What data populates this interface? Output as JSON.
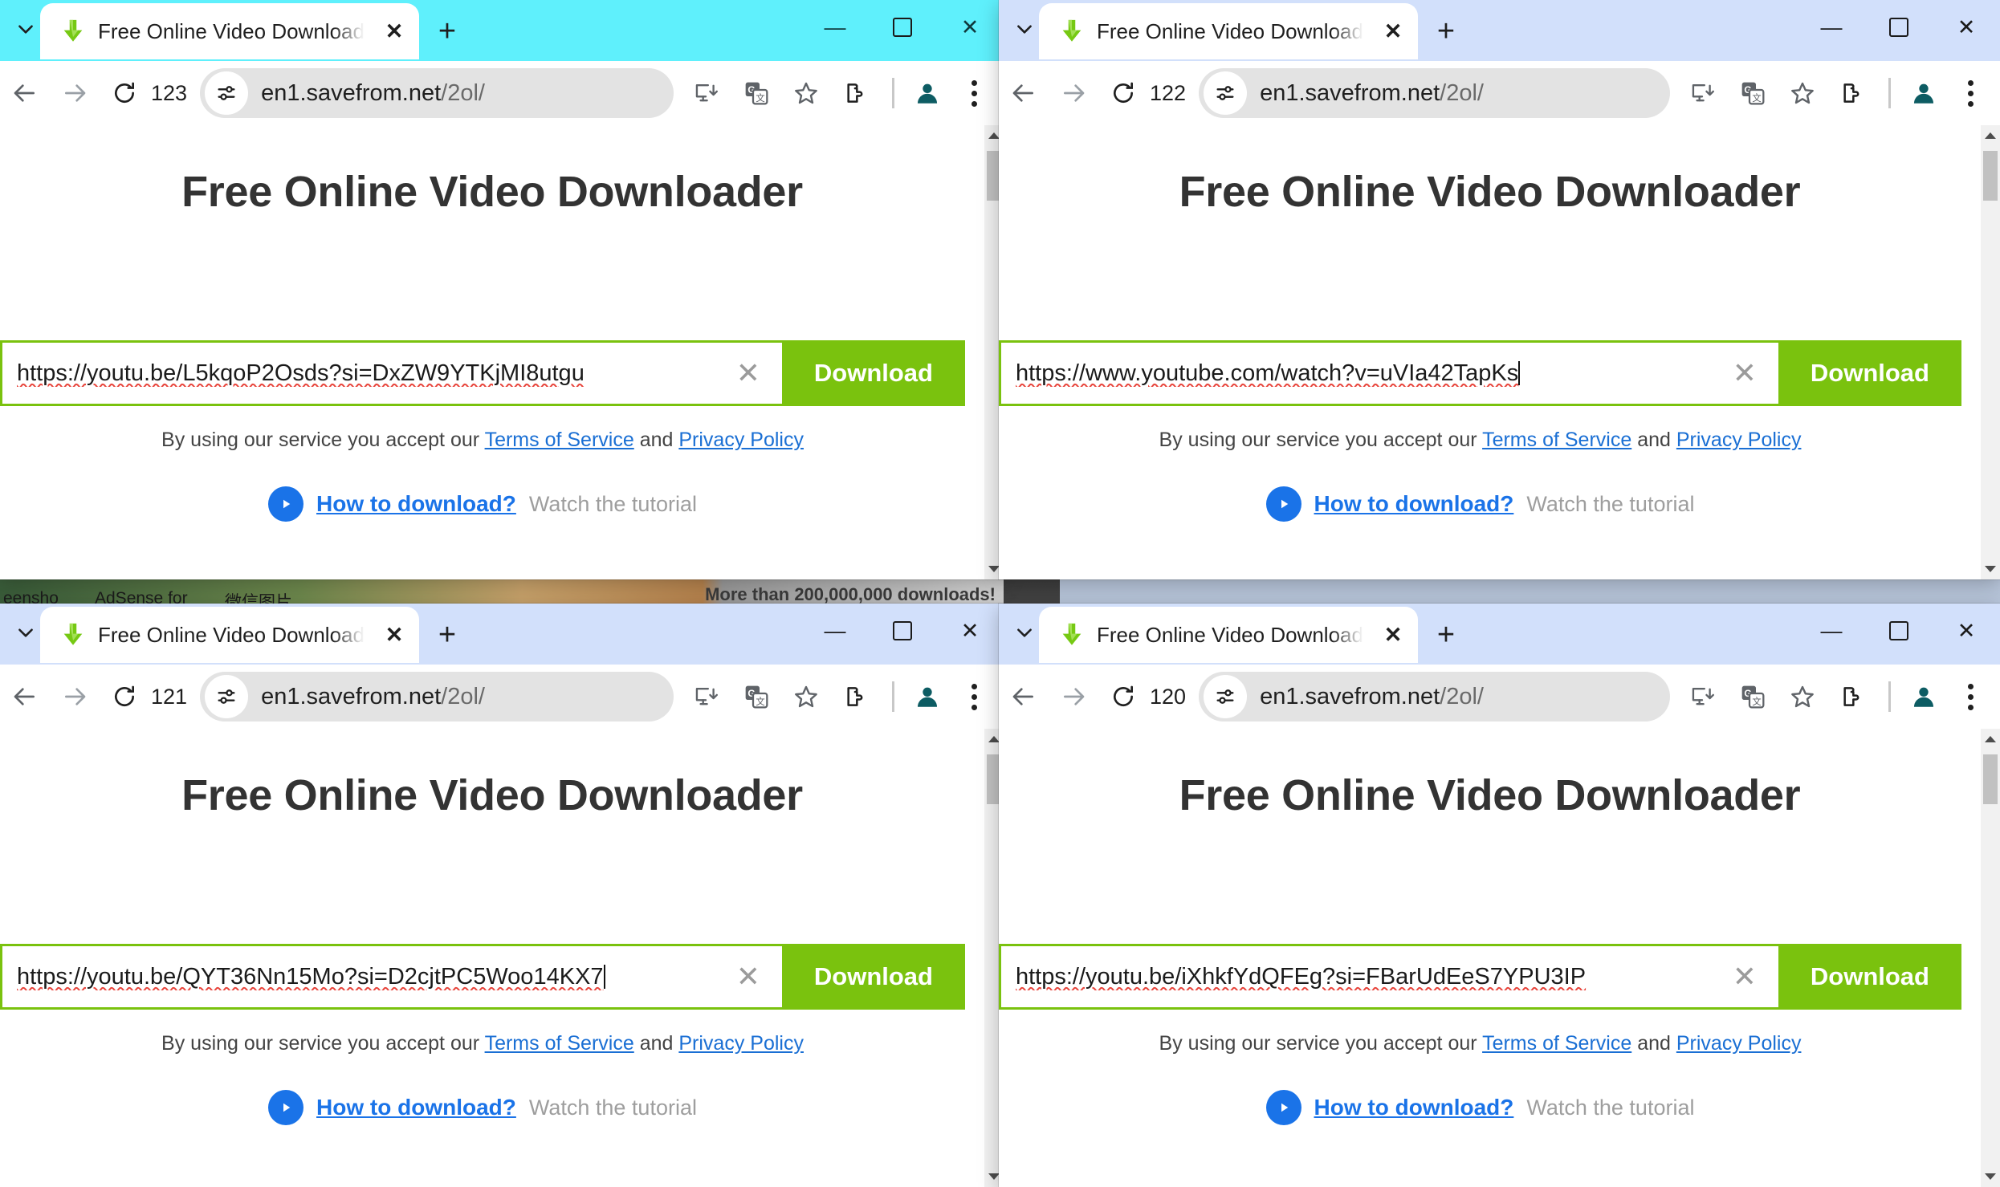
{
  "windows": [
    {
      "id": "window-1",
      "tab": {
        "title": "Free Online Video Downloader",
        "favicon": "green-download-arrow-icon"
      },
      "tabstrip_color": "#5ff0fc",
      "toolbar": {
        "reload_count": "123",
        "url_host": "en1.savefrom.net",
        "url_path": "/2ol/"
      },
      "page": {
        "heading": "Free Online Video Downloader",
        "input_value": "https://youtu.be/L5kqoP2Osds?si=DxZW9YTKjMI8utgu",
        "input_has_caret": false,
        "download_label": "Download",
        "clear_label": "✕",
        "terms_prefix": "By using our service you accept our ",
        "terms_link": "Terms of Service",
        "terms_mid": " and ",
        "privacy_link": "Privacy Policy",
        "howto_link": "How to download?",
        "howto_sub": "Watch the tutorial"
      }
    },
    {
      "id": "window-2",
      "tab": {
        "title": "Free Online Video Downloader",
        "favicon": "green-download-arrow-icon"
      },
      "tabstrip_color": "#d2e0fb",
      "toolbar": {
        "reload_count": "122",
        "url_host": "en1.savefrom.net",
        "url_path": "/2ol/"
      },
      "page": {
        "heading": "Free Online Video Downloader",
        "input_value": "https://www.youtube.com/watch?v=uVIa42TapKs",
        "input_has_caret": true,
        "download_label": "Download",
        "clear_label": "✕",
        "terms_prefix": "By using our service you accept our ",
        "terms_link": "Terms of Service",
        "terms_mid": " and ",
        "privacy_link": "Privacy Policy",
        "howto_link": "How to download?",
        "howto_sub": "Watch the tutorial"
      }
    },
    {
      "id": "window-3",
      "tab": {
        "title": "Free Online Video Downloader",
        "favicon": "green-download-arrow-icon"
      },
      "tabstrip_color": "#d2e0fb",
      "toolbar": {
        "reload_count": "121",
        "url_host": "en1.savefrom.net",
        "url_path": "/2ol/"
      },
      "page": {
        "heading": "Free Online Video Downloader",
        "input_value": "https://youtu.be/QYT36Nn15Mo?si=D2cjtPC5Woo14KX7",
        "input_has_caret": true,
        "download_label": "Download",
        "clear_label": "✕",
        "terms_prefix": "By using our service you accept our ",
        "terms_link": "Terms of Service",
        "terms_mid": " and ",
        "privacy_link": "Privacy Policy",
        "howto_link": "How to download?",
        "howto_sub": "Watch the tutorial"
      }
    },
    {
      "id": "window-4",
      "tab": {
        "title": "Free Online Video Downloader",
        "favicon": "green-download-arrow-icon"
      },
      "tabstrip_color": "#d2e0fb",
      "toolbar": {
        "reload_count": "120",
        "url_host": "en1.savefrom.net",
        "url_path": "/2ol/"
      },
      "page": {
        "heading": "Free Online Video Downloader",
        "input_value": "https://youtu.be/iXhkfYdQFEg?si=FBarUdEeS7YPU3IP",
        "input_has_caret": false,
        "download_label": "Download",
        "clear_label": "✕",
        "terms_prefix": "By using our service you accept our ",
        "terms_link": "Terms of Service",
        "terms_mid": " and ",
        "privacy_link": "Privacy Policy",
        "howto_link": "How to download?",
        "howto_sub": "Watch the tutorial"
      }
    }
  ],
  "window_controls": {
    "minimize": "—",
    "maximize": "☐",
    "close": "✕"
  },
  "tab_controls": {
    "new_tab": "+",
    "close_tab": "✕"
  },
  "background": {
    "strip_items": [
      "eensho",
      "AdSense for",
      "微信图片"
    ],
    "strip_right_text": "More than 200,000,000 downloads!"
  },
  "colors": {
    "accent_green": "#7ac20e",
    "link_blue": "#1a6fd4",
    "howto_blue": "#1a73e8",
    "tabstrip_cyan": "#5ff0fc",
    "tabstrip_lavender": "#d2e0fb",
    "spellcheck_red": "#e8453c"
  }
}
